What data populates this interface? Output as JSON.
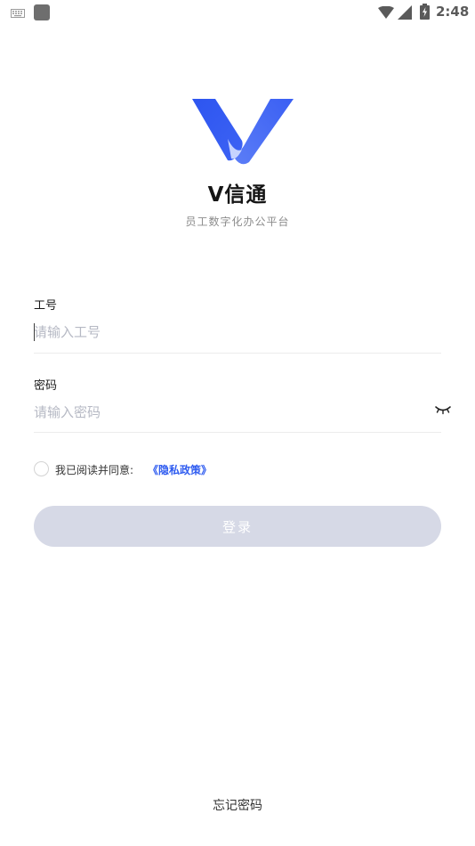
{
  "status_bar": {
    "time": "2:48",
    "icons": [
      "keyboard-icon",
      "notification-square-icon",
      "wifi-icon",
      "signal-icon",
      "battery-icon"
    ]
  },
  "app": {
    "logo_icon": "v-logo-icon",
    "name_prefix": "V",
    "name_suffix": "信通",
    "tagline": "员工数字化办公平台",
    "brand_color": "#3a5cf2"
  },
  "form": {
    "employee_id": {
      "label": "工号",
      "placeholder": "请输入工号",
      "value": ""
    },
    "password": {
      "label": "密码",
      "placeholder": "请输入密码",
      "value": "",
      "toggle_icon": "eye-closed-icon"
    },
    "agreement": {
      "text": "我已阅读并同意:",
      "link": "《隐私政策》",
      "checked": false
    },
    "login_label": "登录",
    "login_bg": "#d6d9e6"
  },
  "footer": {
    "forgot_password": "忘记密码"
  }
}
